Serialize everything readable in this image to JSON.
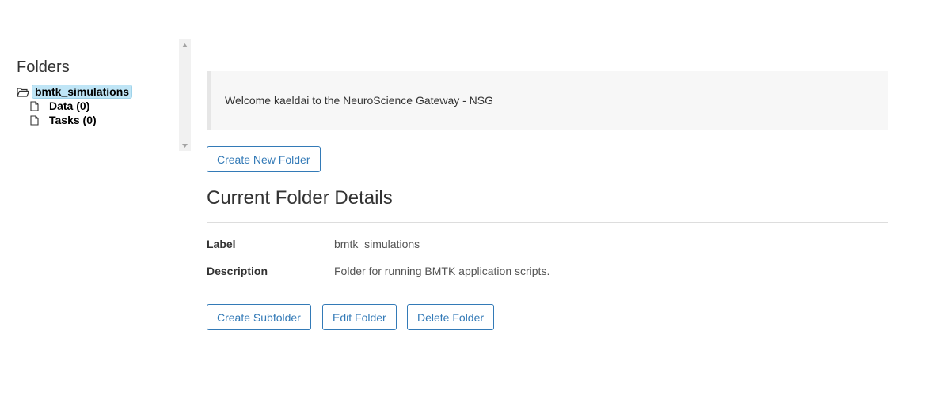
{
  "sidebar": {
    "title": "Folders",
    "tree": {
      "root": {
        "label": "bmtk_simulations",
        "icon": "folder-open-icon",
        "selected": true
      },
      "children": [
        {
          "label": "Data (0)",
          "icon": "file-icon"
        },
        {
          "label": "Tasks (0)",
          "icon": "file-icon"
        }
      ]
    }
  },
  "welcome": {
    "message": "Welcome kaeldai to the NeuroScience Gateway - NSG"
  },
  "actions": {
    "create_new_folder": "Create New Folder"
  },
  "details": {
    "title": "Current Folder Details",
    "label_key": "Label",
    "label_value": "bmtk_simulations",
    "description_key": "Description",
    "description_value": "Folder for running BMTK application scripts."
  },
  "folder_actions": {
    "create_subfolder": "Create Subfolder",
    "edit_folder": "Edit Folder",
    "delete_folder": "Delete Folder"
  },
  "colors": {
    "accent": "#337ab7",
    "selected_highlight": "#bfe5f6",
    "welcome_bg": "#f7f7f7"
  }
}
